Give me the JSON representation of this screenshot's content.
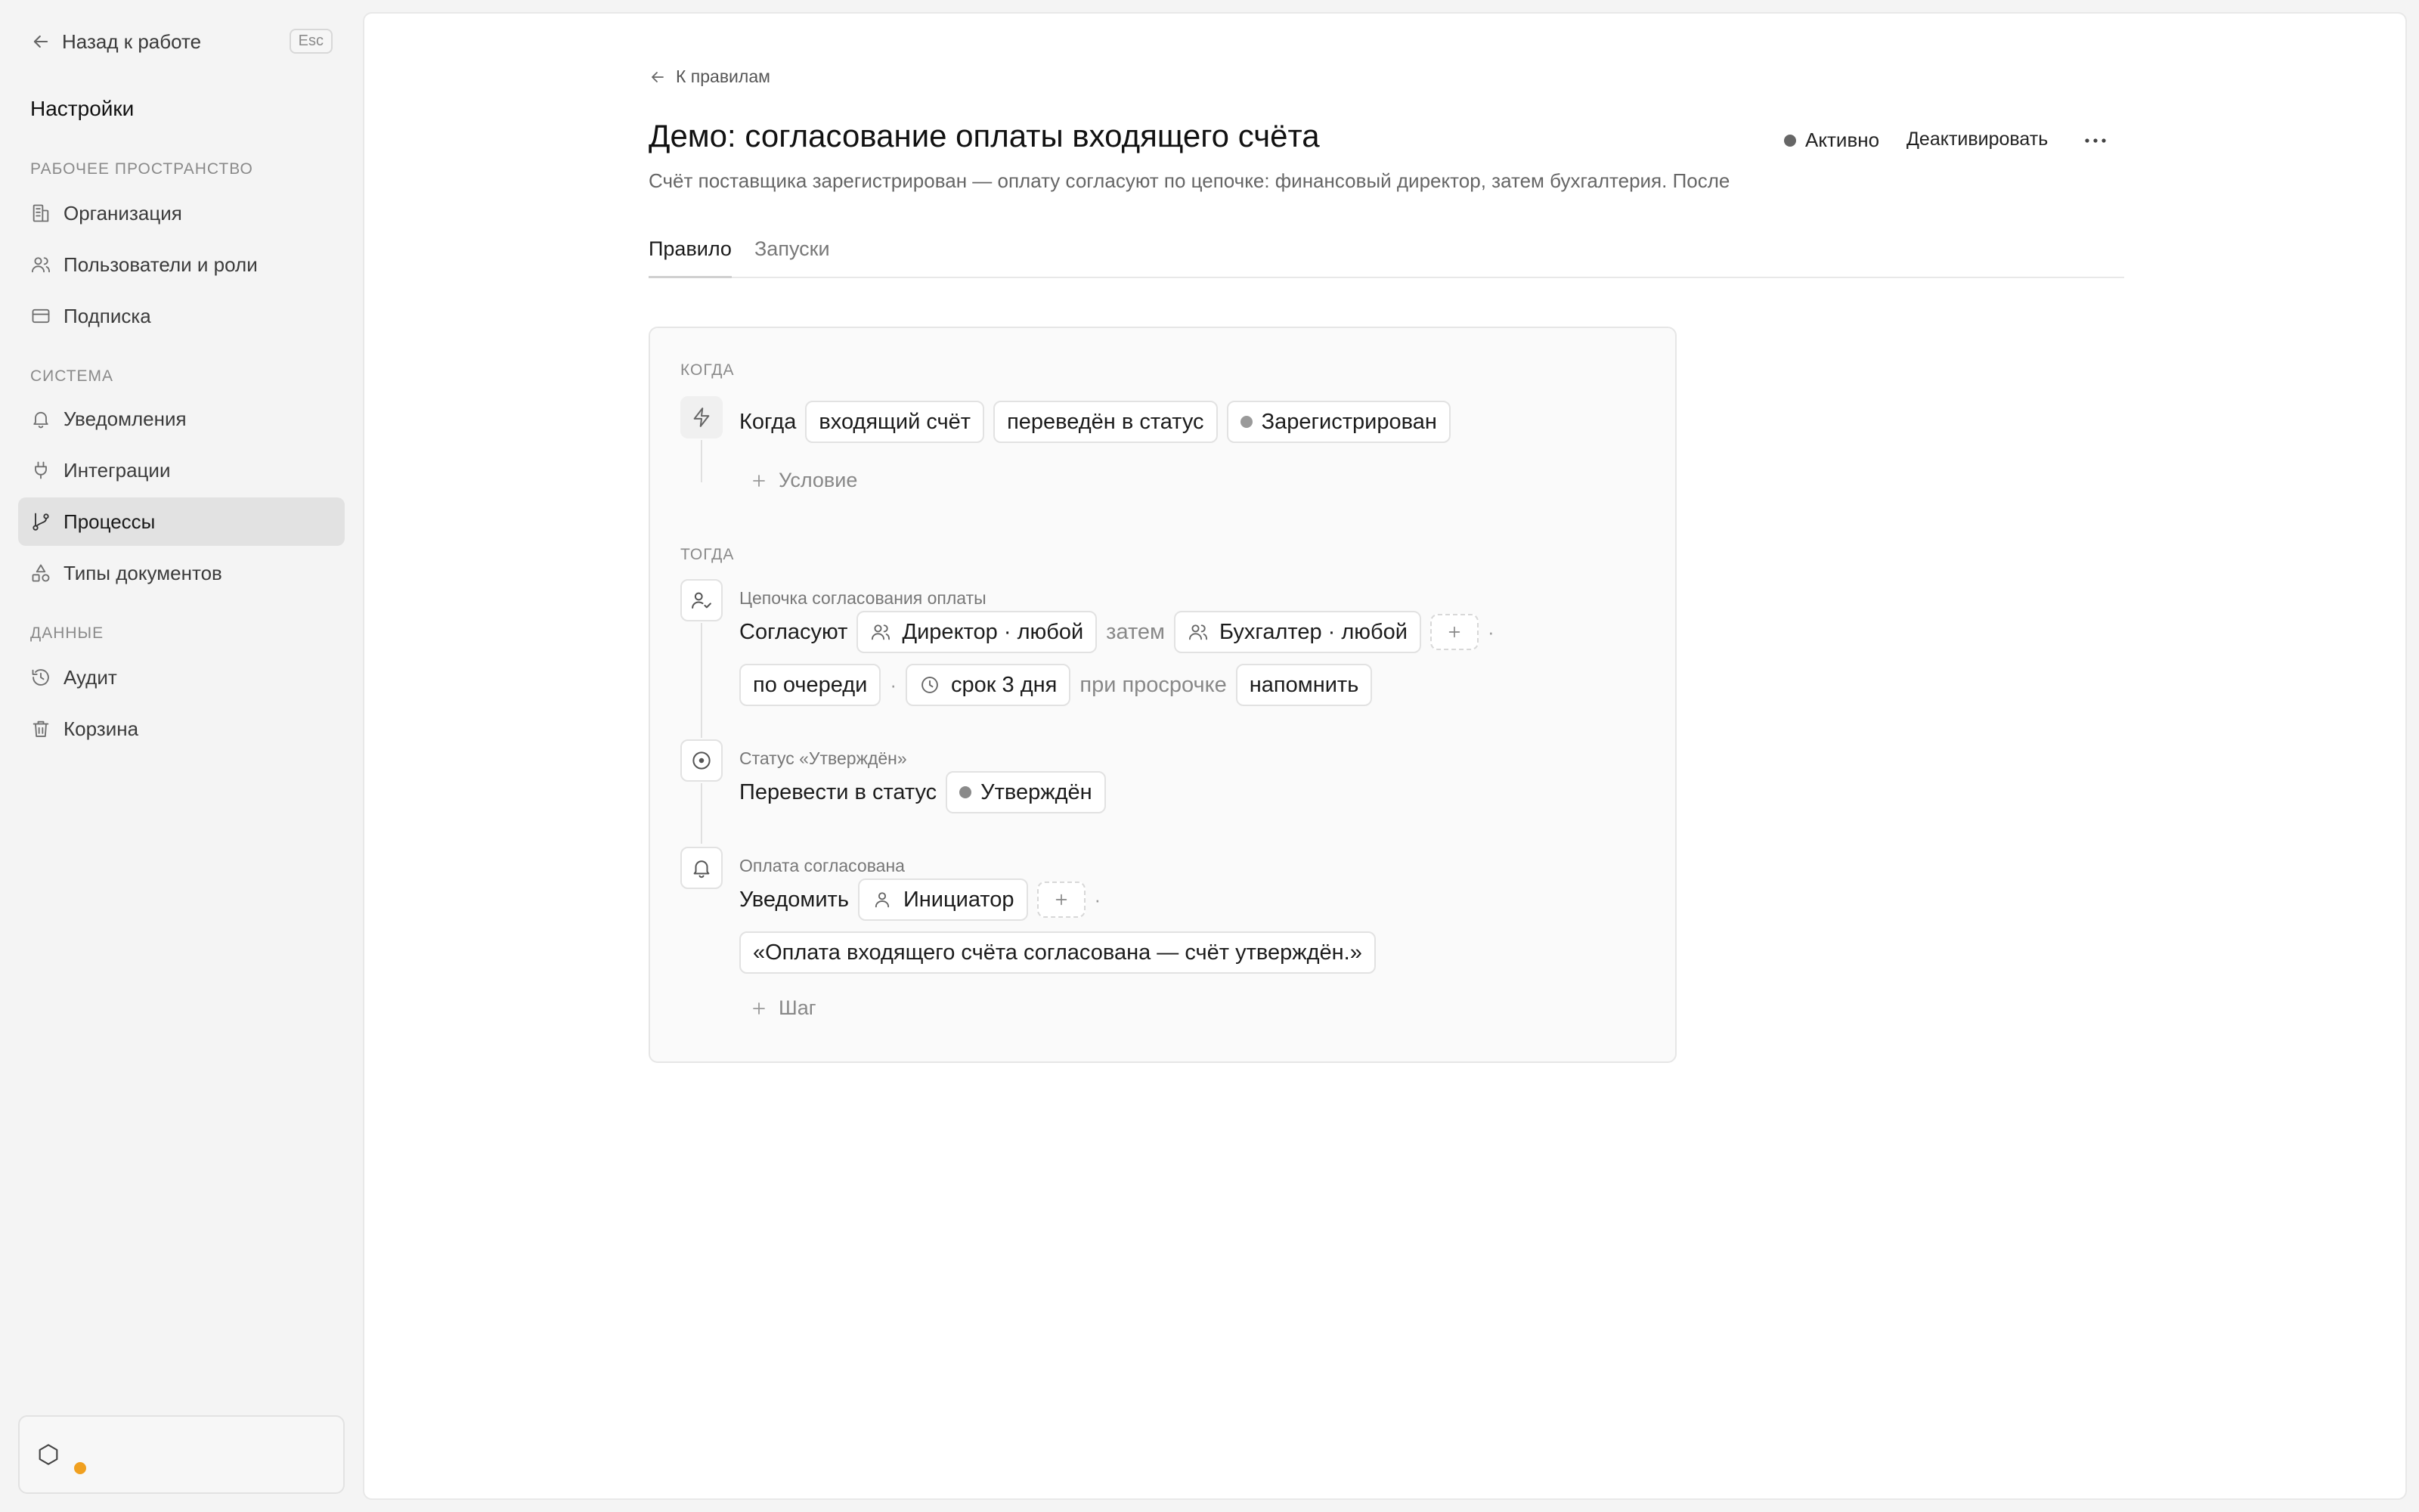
{
  "sidebar": {
    "back_label": "Назад к работе",
    "esc_label": "Esc",
    "title": "Настройки",
    "sections": [
      {
        "label": "РАБОЧЕЕ ПРОСТРАНСТВО",
        "items": [
          {
            "label": "Организация",
            "icon": "building-icon"
          },
          {
            "label": "Пользователи и роли",
            "icon": "users-icon"
          },
          {
            "label": "Подписка",
            "icon": "credit-card-icon"
          }
        ]
      },
      {
        "label": "СИСТЕМА",
        "items": [
          {
            "label": "Уведомления",
            "icon": "bell-icon"
          },
          {
            "label": "Интеграции",
            "icon": "plug-icon"
          },
          {
            "label": "Процессы",
            "icon": "git-branch-icon",
            "active": true
          },
          {
            "label": "Типы документов",
            "icon": "shapes-icon"
          }
        ]
      },
      {
        "label": "ДАННЫЕ",
        "items": [
          {
            "label": "Аудит",
            "icon": "history-icon"
          },
          {
            "label": "Корзина",
            "icon": "trash-icon"
          }
        ]
      }
    ],
    "footer": {
      "icon": "hexagon-icon",
      "indicator_color": "#f0a020"
    }
  },
  "main": {
    "breadcrumb": "К правилам",
    "title": "Демо: согласование оплаты входящего счёта",
    "description": "Счёт поставщика зарегистрирован — оплату согласуют по цепочке: финансовый директор, затем бухгалтерия. После",
    "status_label": "Активно",
    "deactivate_label": "Деактивировать",
    "more_icon": "more-horizontal-icon",
    "tabs": [
      {
        "label": "Правило",
        "active": true
      },
      {
        "label": "Запуски",
        "active": false
      }
    ]
  },
  "rule": {
    "when_label": "КОГДА",
    "trigger": {
      "icon": "zap-icon",
      "word": "Когда",
      "entity": "входящий счёт",
      "event": "переведён в статус",
      "status": "Зарегистрирован"
    },
    "add_condition": "Условие",
    "then_label": "ТОГДА",
    "steps": {
      "approval": {
        "icon": "user-check-icon",
        "caption": "Цепочка согласования оплаты",
        "verb": "Согласуют",
        "approver1": "Директор · любой",
        "then_word": "затем",
        "approver2": "Бухгалтер · любой",
        "order": "по очереди",
        "deadline": "срок 3 дня",
        "overdue_word": "при просрочке",
        "overdue_action": "напомнить"
      },
      "status_change": {
        "icon": "circle-dot-icon",
        "caption": "Статус «Утверждён»",
        "verb": "Перевести в статус",
        "status": "Утверждён"
      },
      "notify": {
        "icon": "bell-icon",
        "caption": "Оплата согласована",
        "verb": "Уведомить",
        "recipient": "Инициатор",
        "message": "«Оплата входящего счёта согласована — счёт утверждён.»"
      }
    },
    "add_step": "Шаг"
  }
}
